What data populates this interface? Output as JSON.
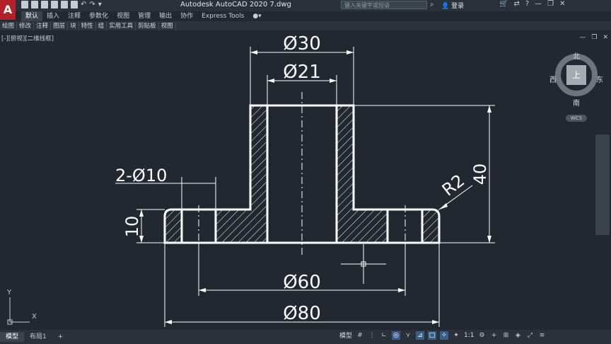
{
  "titlebar": {
    "app_logo": "A",
    "title": "Autodesk AutoCAD 2020     7.dwg",
    "search_placeholder": "键入关键字或短语",
    "login": "登录"
  },
  "ribbon": {
    "tabs": [
      "默认",
      "插入",
      "注释",
      "参数化",
      "视图",
      "管理",
      "输出",
      "协作",
      "Express Tools"
    ],
    "active_tab": "默认",
    "panels": [
      "绘图",
      "修改",
      "注释",
      "图层",
      "块",
      "特性",
      "组",
      "实用工具",
      "剪贴板",
      "视图"
    ]
  },
  "viewport": {
    "label": "[-][俯视][二维线框]",
    "viewcube": {
      "north": "北",
      "south": "南",
      "west": "西",
      "east": "东",
      "top": "上",
      "wcs": "WCS"
    },
    "ucs": {
      "y": "Y",
      "x": "X"
    }
  },
  "dimensions": {
    "d30": "Ø30",
    "d21": "Ø21",
    "holes": "2-Ø10",
    "h10": "10",
    "h40": "40",
    "r2": "R2",
    "d60": "Ø60",
    "d80": "Ø80"
  },
  "layout_tabs": [
    "模型",
    "布局1",
    "+"
  ],
  "statusbar": {
    "model_label": "模型",
    "scale": "1:1"
  },
  "colors": {
    "canvas": "#212830",
    "object_lines": "#ffffff",
    "accent": "#3a5f86"
  }
}
